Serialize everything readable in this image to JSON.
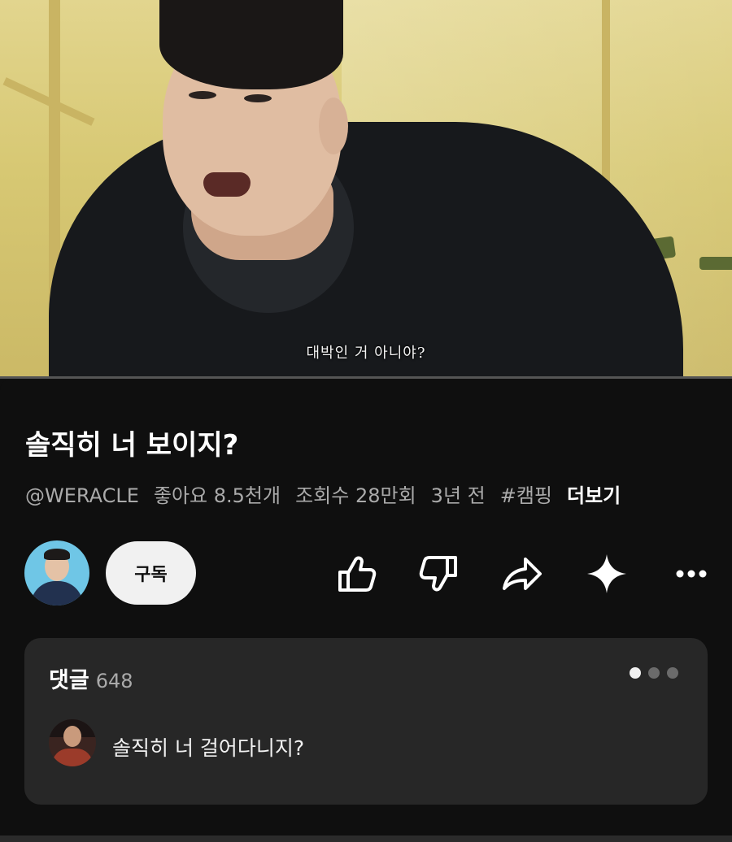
{
  "video": {
    "subtitle": "대박인 거 아니야?",
    "progress_percent": 0
  },
  "info": {
    "title": "솔직히 너 보이지?",
    "channel": "@WERACLE",
    "likes": "좋아요 8.5천개",
    "views": "조회수 28만회",
    "age": "3년 전",
    "hashtag": "#캠핑",
    "more_label": "더보기"
  },
  "actions": {
    "subscribe_label": "구독",
    "icons": [
      "like-icon",
      "dislike-icon",
      "share-icon",
      "sparkle-icon",
      "more-icon"
    ]
  },
  "comments": {
    "title": "댓글",
    "count": "648",
    "pager_total": 3,
    "pager_active": 0,
    "top_comment": "솔직히 너 걸어다니지?"
  },
  "colors": {
    "background": "#0f0f0f",
    "card": "#272727",
    "subscribe_bg": "#f1f1f1",
    "meta_text": "#aaaaaa"
  }
}
